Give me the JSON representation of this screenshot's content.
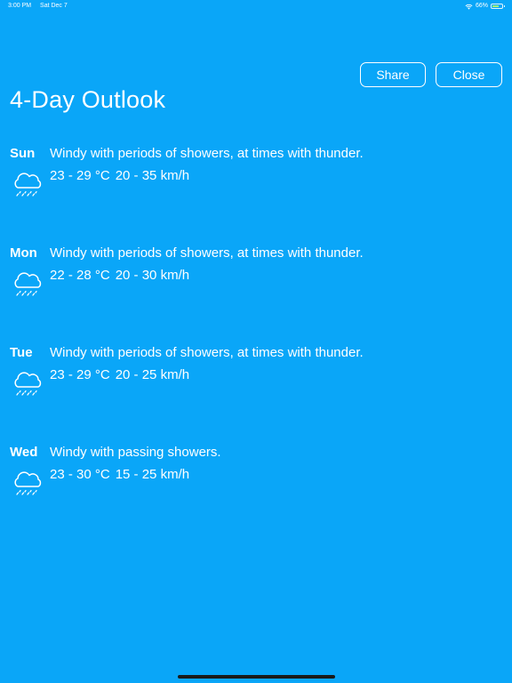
{
  "status_bar": {
    "time": "3:00 PM",
    "date": "Sat Dec 7",
    "battery_percent": "66%",
    "battery_level": 0.66
  },
  "header": {
    "title": "4-Day Outlook",
    "share_label": "Share",
    "close_label": "Close"
  },
  "forecast": [
    {
      "day": "Sun",
      "description": "Windy with periods of showers, at times with thunder.",
      "temperature": "23 - 29 °C",
      "wind": "20 - 35 km/h",
      "icon": "rain-cloud-icon"
    },
    {
      "day": "Mon",
      "description": "Windy with periods of showers, at times with thunder.",
      "temperature": "22 - 28 °C",
      "wind": "20 - 30 km/h",
      "icon": "rain-cloud-icon"
    },
    {
      "day": "Tue",
      "description": "Windy with periods of showers, at times with thunder.",
      "temperature": "23 - 29 °C",
      "wind": "20 - 25 km/h",
      "icon": "rain-cloud-icon"
    },
    {
      "day": "Wed",
      "description": "Windy with passing showers.",
      "temperature": "23 - 30 °C",
      "wind": "15 - 25 km/h",
      "icon": "rain-cloud-icon"
    }
  ],
  "colors": {
    "background": "#0aa6f8",
    "text": "#ffffff"
  }
}
